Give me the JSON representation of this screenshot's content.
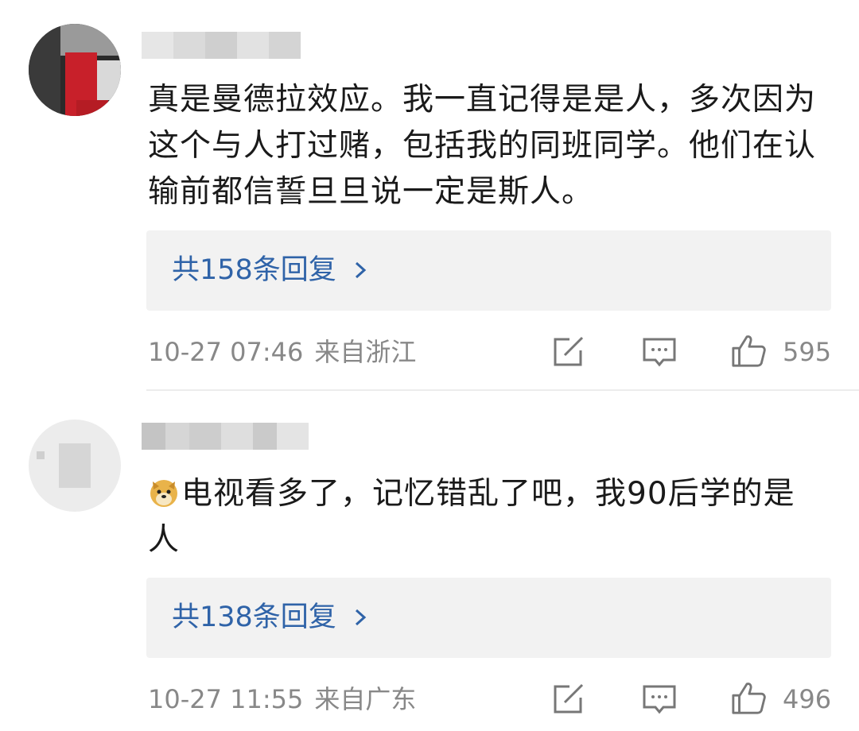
{
  "comments": [
    {
      "text": "真是曼德拉效应。我一直记得是是人，多次因为这个与人打过赌，包括我的同班同学。他们在认输前都信誓旦旦说一定是斯人。",
      "replies_label": "共158条回复",
      "timestamp": "10-27 07:46",
      "location": "来自浙江",
      "like_count": "595"
    },
    {
      "emoji": "doge-emoji",
      "text": "电视看多了，记忆错乱了吧，我90后学的是人",
      "replies_label": "共138条回复",
      "timestamp": "10-27 11:55",
      "location": "来自广东",
      "like_count": "496"
    }
  ],
  "icons": {
    "repost": "repost-icon",
    "comment": "comment-icon",
    "like": "like-icon",
    "chevron": "chevron-right-icon"
  },
  "colors": {
    "link": "#2f63a8",
    "meta": "#888888",
    "reply_bg": "#f2f2f2"
  }
}
